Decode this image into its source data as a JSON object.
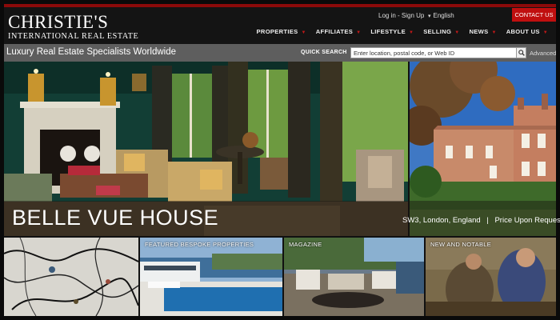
{
  "header": {
    "logo_main": "CHRISTIE'S",
    "logo_sub": "INTERNATIONAL REAL ESTATE",
    "login_label": "Log in - Sign Up",
    "language_label": "English",
    "contact_label": "CONTACT US",
    "nav": [
      "PROPERTIES",
      "AFFILIATES",
      "LIFESTYLE",
      "SELLING",
      "NEWS",
      "ABOUT US"
    ]
  },
  "search_bar": {
    "tagline": "Luxury Real Estate Specialists Worldwide",
    "quick_search_label": "QUICK SEARCH",
    "placeholder": "Enter location, postal code, or Web ID",
    "advanced_label": "Advanced"
  },
  "hero": {
    "title": "BELLE VUE HOUSE",
    "location": "SW3, London, England",
    "price": "Price Upon Request",
    "separator": "|"
  },
  "tiles": [
    {
      "label": ""
    },
    {
      "label": "FEATURED BESPOKE PROPERTIES"
    },
    {
      "label": "MAGAZINE"
    },
    {
      "label": "NEW AND NOTABLE"
    }
  ],
  "colors": {
    "accent_red": "#c00f0f",
    "header_bg": "#141414",
    "bar_bg": "#5e5e5e"
  },
  "icons": {
    "search_button": "search-icon",
    "nav_dropdown": "caret-down-icon",
    "language_dropdown": "caret-down-icon"
  }
}
